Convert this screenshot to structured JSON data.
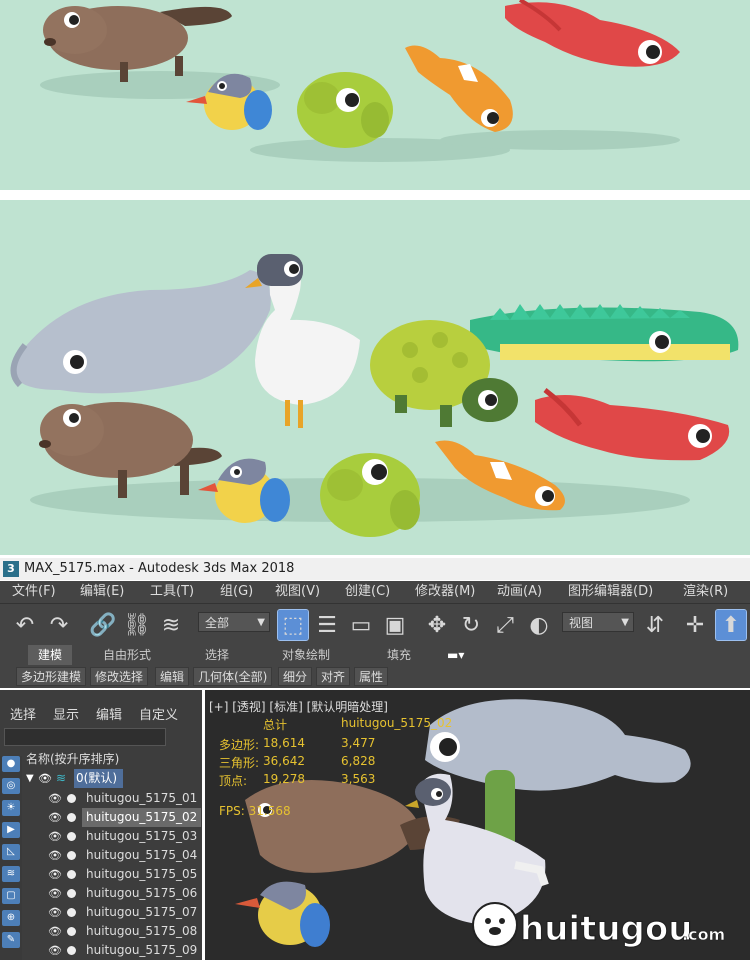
{
  "window": {
    "app_icon": "3",
    "title": "MAX_5175.max - Autodesk 3ds Max 2018"
  },
  "menubar": [
    "文件(F)",
    "编辑(E)",
    "工具(T)",
    "组(G)",
    "视图(V)",
    "创建(C)",
    "修改器(M)",
    "动画(A)",
    "图形编辑器(D)",
    "渲染(R)"
  ],
  "toolbar": {
    "selection_filter": "全部",
    "reference_coord": "视图",
    "icons": [
      "undo-icon",
      "redo-icon",
      "link-icon",
      "unlink-icon",
      "bind-spacewarp-icon",
      "select-object-icon",
      "select-by-name-icon",
      "rect-region-icon",
      "window-crossing-icon",
      "move-icon",
      "rotate-icon",
      "scale-icon",
      "select-manipulate-icon",
      "mirror-icon",
      "align-icon",
      "active-icon"
    ]
  },
  "ribbon": {
    "tabs": [
      "建模",
      "自由形式",
      "选择",
      "对象绘制",
      "填充"
    ],
    "active_tab": "建模",
    "sub": [
      "多边形建模",
      "修改选择",
      "编辑",
      "几何体(全部)",
      "细分",
      "对齐",
      "属性"
    ]
  },
  "scene_explorer": {
    "menu": [
      "选择",
      "显示",
      "编辑",
      "自定义"
    ],
    "column_header": "名称(按升序排序)",
    "layer": "0(默认)",
    "objects": [
      "huitugou_5175_01",
      "huitugou_5175_02",
      "huitugou_5175_03",
      "huitugou_5175_04",
      "huitugou_5175_05",
      "huitugou_5175_06",
      "huitugou_5175_07",
      "huitugou_5175_08",
      "huitugou_5175_09"
    ],
    "selected_index": 1
  },
  "viewport": {
    "label": "[+] [透视] [标准] [默认明暗处理]",
    "stats": {
      "col_total": "总计",
      "col_object": "huitugou_5175_02",
      "rows": [
        {
          "label": "多边形:",
          "total": "18,614",
          "object": "3,477"
        },
        {
          "label": "三角形:",
          "total": "36,642",
          "object": "6,828"
        },
        {
          "label": "顶点:",
          "total": "19,278",
          "object": "3,563"
        }
      ]
    },
    "fps_label": "FPS:",
    "fps_value": "31.568"
  },
  "watermark": {
    "text": "huitugou",
    "suffix": ".com"
  },
  "colors": {
    "render_bg": "#bfe3d1",
    "ui_bg": "#444444",
    "viewport_bg": "#2b2b2b",
    "accent": "#5c8fd6",
    "stats": "#e6c230"
  }
}
